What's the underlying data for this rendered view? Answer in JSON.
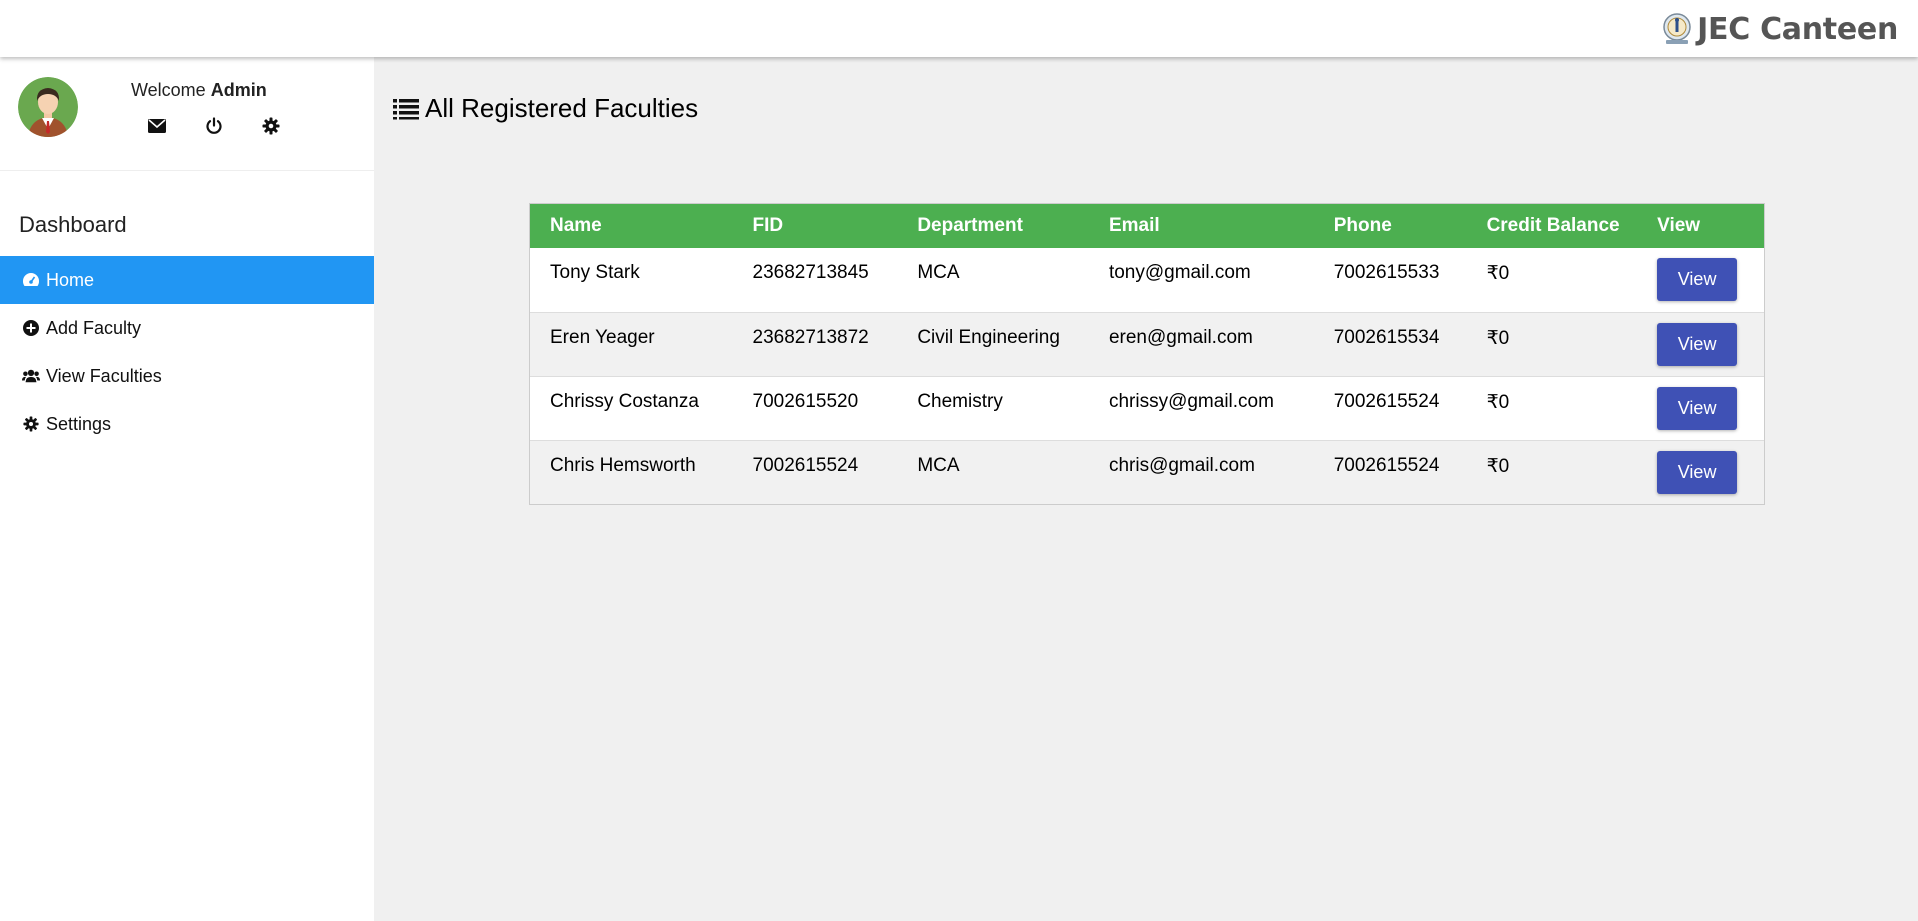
{
  "brand": {
    "name": "JEC Canteen",
    "logo_icon": "emblem-logo"
  },
  "profile": {
    "welcome_prefix": "Welcome ",
    "user_name": "Admin",
    "icons": [
      "envelope-icon",
      "power-icon",
      "gear-icon"
    ]
  },
  "sidebar": {
    "title": "Dashboard",
    "items": [
      {
        "label": "Home",
        "icon": "dashboard-icon",
        "active": true
      },
      {
        "label": "Add Faculty",
        "icon": "plus-circle-icon",
        "active": false
      },
      {
        "label": "View Faculties",
        "icon": "users-icon",
        "active": false
      },
      {
        "label": "Settings",
        "icon": "gear-icon",
        "active": false
      }
    ]
  },
  "main": {
    "title": "All Registered Faculties",
    "title_icon": "list-icon"
  },
  "table": {
    "headers": [
      "Name",
      "FID",
      "Department",
      "Email",
      "Phone",
      "Credit Balance",
      "View"
    ],
    "rows": [
      {
        "name": "Tony Stark",
        "fid": "23682713845",
        "department": "MCA",
        "email": "tony@gmail.com",
        "phone": "7002615533",
        "credit": "₹0",
        "action": "View"
      },
      {
        "name": "Eren Yeager",
        "fid": "23682713872",
        "department": "Civil Engineering",
        "email": "eren@gmail.com",
        "phone": "7002615534",
        "credit": "₹0",
        "action": "View"
      },
      {
        "name": "Chrissy Costanza",
        "fid": "7002615520",
        "department": "Chemistry",
        "email": "chrissy@gmail.com",
        "phone": "7002615524",
        "credit": "₹0",
        "action": "View"
      },
      {
        "name": "Chris Hemsworth",
        "fid": "7002615524",
        "department": "MCA",
        "email": "chris@gmail.com",
        "phone": "7002615524",
        "credit": "₹0",
        "action": "View"
      }
    ]
  },
  "colors": {
    "header_green": "#4caf50",
    "active_blue": "#2196f3",
    "button_indigo": "#3f51b5"
  }
}
